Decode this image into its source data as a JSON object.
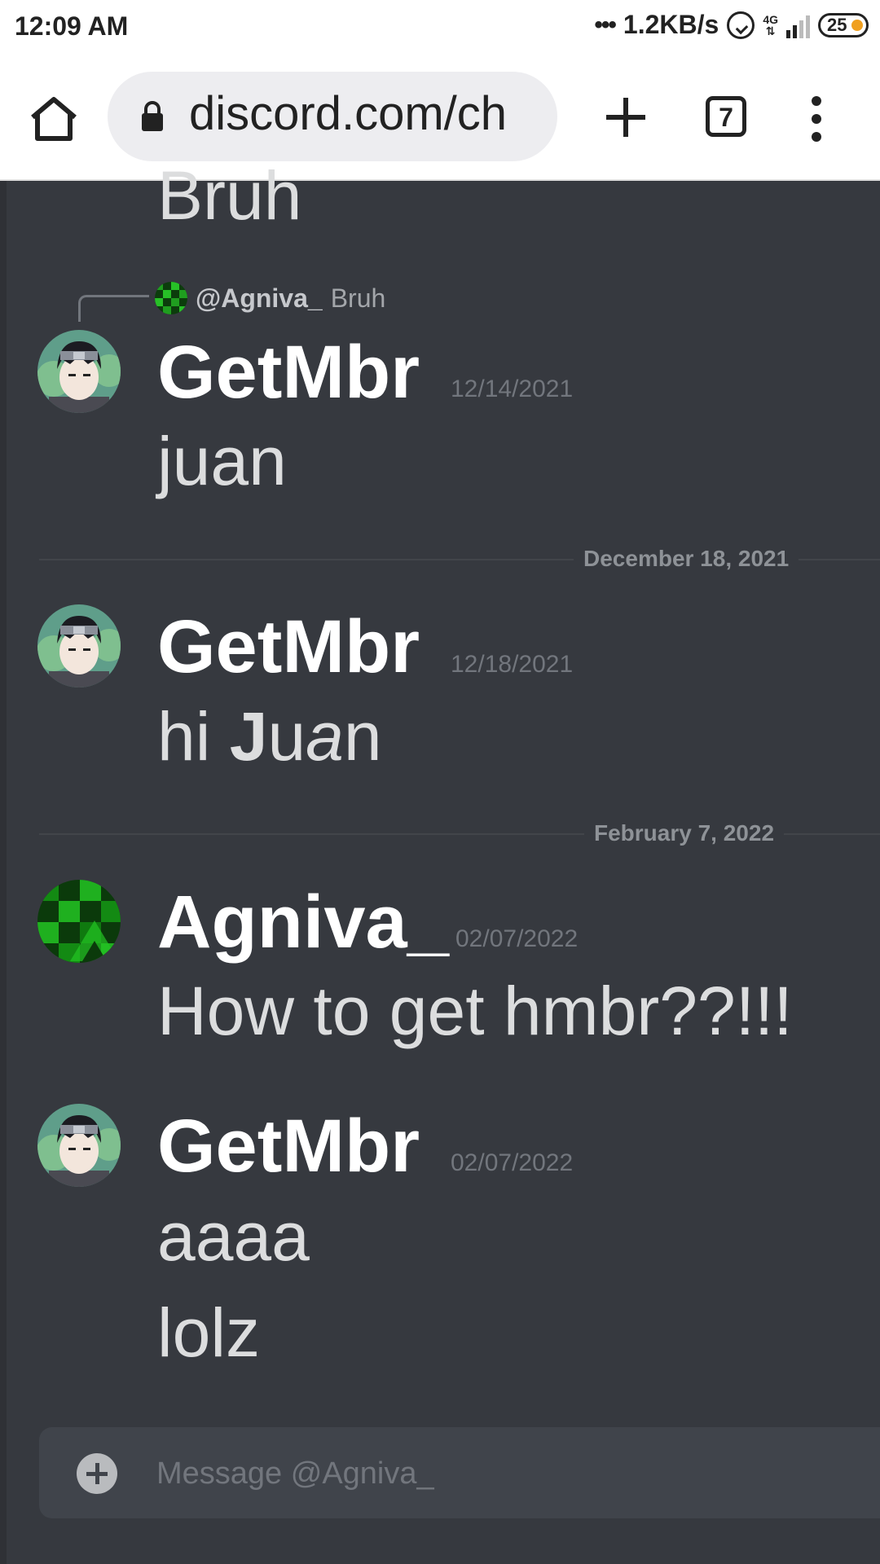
{
  "status_bar": {
    "time": "12:09 AM",
    "net_speed": "1.2KB/s",
    "network_type": "4G",
    "battery": "25"
  },
  "browser": {
    "url": "discord.com/ch",
    "tab_count": "7",
    "icons": [
      "home-icon",
      "lock-icon",
      "plus-icon",
      "tabs-icon",
      "more-vert-icon"
    ]
  },
  "chat": {
    "top_fragment": "Bruh",
    "reply": {
      "author": "@Agniva_",
      "text": "Bruh"
    },
    "messages": [
      {
        "author": "GetMbr",
        "timestamp": "12/14/2021",
        "lines": [
          "juan"
        ]
      },
      {
        "author": "GetMbr",
        "timestamp": "12/18/2021",
        "lines": [
          "hi Juan"
        ]
      },
      {
        "author": "Agniva_",
        "timestamp": "02/07/2022",
        "lines": [
          "How to get hmbr??!!!"
        ]
      },
      {
        "author": "GetMbr",
        "timestamp": "02/07/2022",
        "lines": [
          "aaaa",
          "lolz"
        ]
      }
    ],
    "dividers": [
      "December 18, 2021",
      "February 7, 2022"
    ],
    "message_2_parts": [
      "hi ",
      "J",
      "u",
      "a",
      "n"
    ]
  },
  "composer": {
    "placeholder": "Message @Agniva_"
  },
  "colors": {
    "background": "#36393f",
    "username": "#ffffff",
    "message_text": "#dcddde",
    "timestamp": "#72767d",
    "composer": "#40444b"
  }
}
